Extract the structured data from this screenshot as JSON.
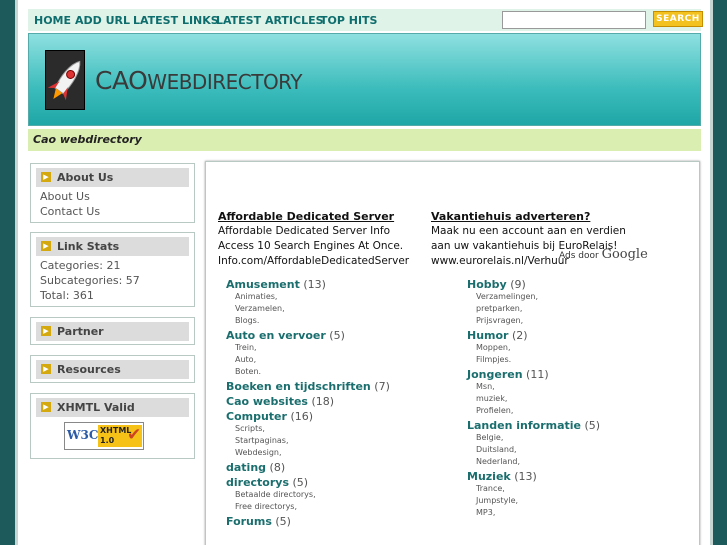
{
  "nav": {
    "links": [
      "HOME",
      "ADD URL",
      "LATEST LINKS",
      "LATEST ARTICLES",
      "TOP HITS"
    ],
    "search_placeholder": "",
    "search_button": "SEARCH"
  },
  "header": {
    "logo_text_main": "CAO",
    "logo_text_rest": "WEBDIRECTORY"
  },
  "tagline": "Cao webdirectory",
  "sidebar": {
    "about": {
      "title": "About Us",
      "links": [
        "About Us",
        "Contact Us"
      ]
    },
    "stats": {
      "title": "Link Stats",
      "lines": [
        "Categories: 21",
        "Subcategories: 57",
        "Total: 361"
      ]
    },
    "partner": {
      "title": "Partner"
    },
    "resources": {
      "title": "Resources"
    },
    "valid": {
      "title": "XHMTL Valid",
      "badge_left": "W3C",
      "badge_right_1": "XHTML",
      "badge_right_2": "1.0"
    }
  },
  "ads": [
    {
      "title": "Affordable Dedicated Server",
      "body": "Affordable Dedicated Server Info Access 10 Search Engines At Once.",
      "url": "Info.com/AffordableDedicatedServer"
    },
    {
      "title": "Vakantiehuis adverteren?",
      "body": "Maak nu een account aan en verdien aan uw vakantiehuis bij EuroRelais!",
      "url": "www.eurorelais.nl/Verhuur"
    }
  ],
  "ads_by": {
    "label": "Ads door",
    "brand": "Google"
  },
  "categories_left": [
    {
      "name": "Amusement",
      "count": "(13)",
      "subs": [
        "Animaties,",
        "Verzamelen,",
        "Blogs."
      ]
    },
    {
      "name": "Auto en vervoer",
      "count": "(5)",
      "subs": [
        "Trein,",
        "Auto,",
        "Boten."
      ]
    },
    {
      "name": "Boeken en tijdschriften",
      "count": "(7)",
      "subs": []
    },
    {
      "name": "Cao websites",
      "count": "(18)",
      "subs": []
    },
    {
      "name": "Computer",
      "count": "(16)",
      "subs": [
        "Scripts,",
        "Startpaginas,",
        "Webdesign,"
      ]
    },
    {
      "name": "dating",
      "count": "(8)",
      "subs": []
    },
    {
      "name": "directorys",
      "count": "(5)",
      "subs": [
        "Betaalde directorys,",
        "Free directorys,"
      ]
    },
    {
      "name": "Forums",
      "count": "(5)",
      "subs": []
    }
  ],
  "categories_right": [
    {
      "name": "Hobby",
      "count": "(9)",
      "subs": [
        "Verzamelingen,",
        "pretparken,",
        "Prijsvragen,"
      ]
    },
    {
      "name": "Humor",
      "count": "(2)",
      "subs": [
        "Moppen,",
        "Filmpjes."
      ]
    },
    {
      "name": "Jongeren",
      "count": "(11)",
      "subs": [
        "Msn,",
        "muziek,",
        "Profielen,"
      ]
    },
    {
      "name": "Landen informatie",
      "count": "(5)",
      "subs": [
        "Belgie,",
        "Duitsland,",
        "Nederland,"
      ]
    },
    {
      "name": "Muziek",
      "count": "(13)",
      "subs": [
        "Trance,",
        "Jumpstyle,",
        "MP3,"
      ]
    }
  ]
}
